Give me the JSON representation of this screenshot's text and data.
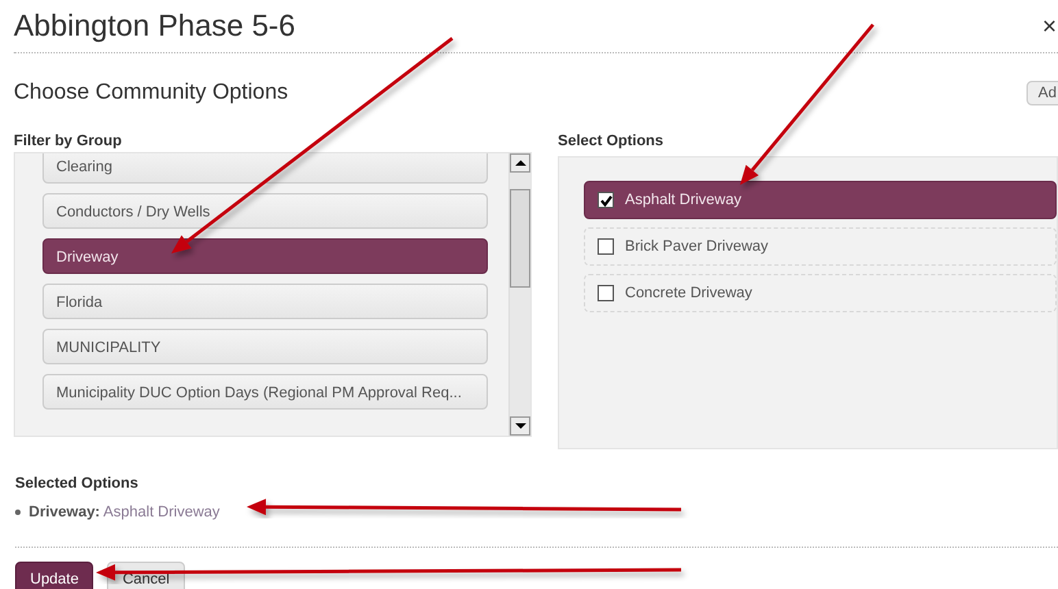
{
  "dialog": {
    "title": "Abbington Phase 5-6",
    "close": "×"
  },
  "heading": "Choose Community Options",
  "add_button": "Ad",
  "filter": {
    "label": "Filter by Group",
    "groups": [
      {
        "label": "Clearing",
        "selected": false
      },
      {
        "label": "Conductors / Dry Wells",
        "selected": false
      },
      {
        "label": "Driveway",
        "selected": true
      },
      {
        "label": "Florida",
        "selected": false
      },
      {
        "label": "MUNICIPALITY",
        "selected": false
      },
      {
        "label": "Municipality DUC Option Days (Regional PM Approval Req...",
        "selected": false
      }
    ]
  },
  "options": {
    "label": "Select Options",
    "items": [
      {
        "label": "Asphalt Driveway",
        "checked": true
      },
      {
        "label": "Brick Paver Driveway",
        "checked": false
      },
      {
        "label": "Concrete Driveway",
        "checked": false
      }
    ]
  },
  "selected_options": {
    "label": "Selected Options",
    "items": [
      {
        "group": "Driveway:",
        "value": "Asphalt Driveway"
      }
    ]
  },
  "buttons": [
    {
      "label": "Update",
      "kind": "primary"
    },
    {
      "label": "Cancel",
      "kind": "secondary"
    }
  ],
  "callout_arrows": [
    {
      "kind": "group"
    },
    {
      "kind": "option"
    },
    {
      "kind": "summary"
    },
    {
      "kind": "button"
    }
  ]
}
